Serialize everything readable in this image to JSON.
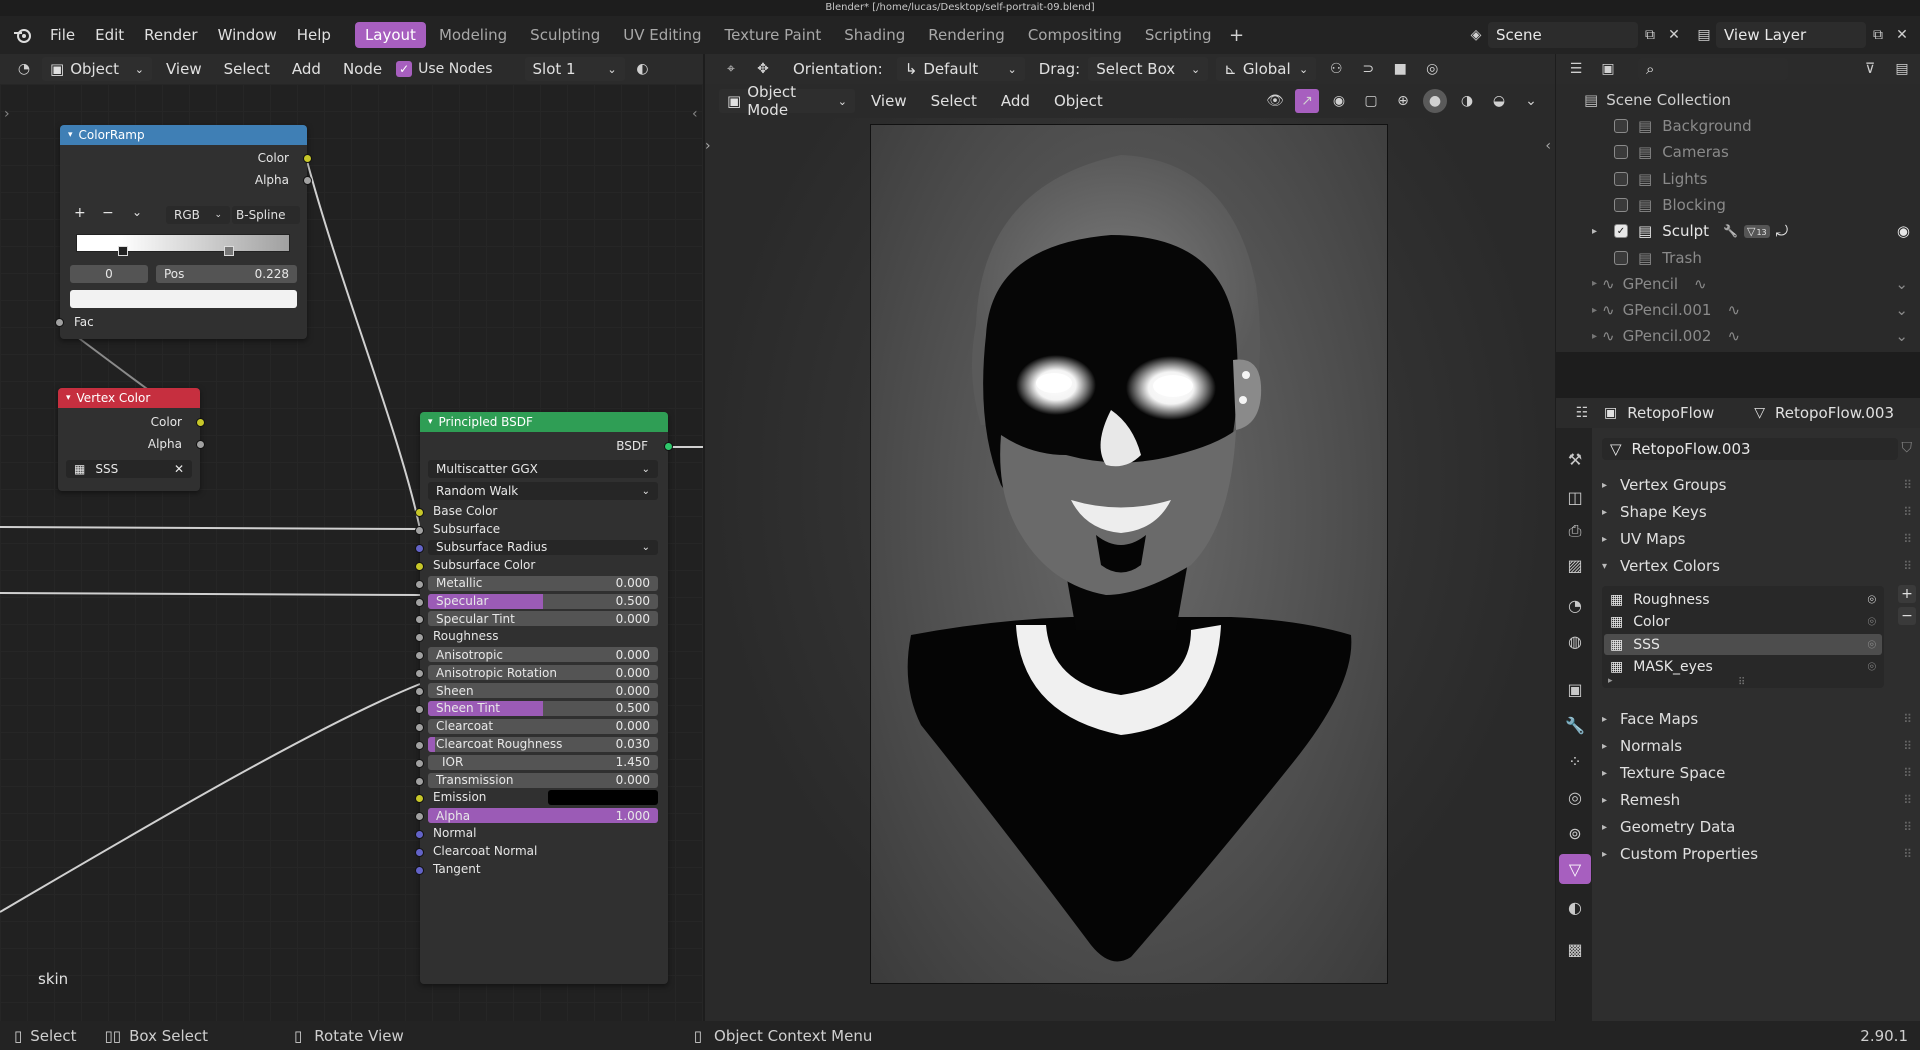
{
  "window_title": "Blender* [/home/lucas/Desktop/self-portrait-09.blend]",
  "menu": [
    "File",
    "Edit",
    "Render",
    "Window",
    "Help"
  ],
  "workspaces": [
    "Layout",
    "Modeling",
    "Sculpting",
    "UV Editing",
    "Texture Paint",
    "Shading",
    "Rendering",
    "Compositing",
    "Scripting"
  ],
  "active_workspace": "Layout",
  "scene": "Scene",
  "view_layer": "View Layer",
  "node_editor": {
    "object_type": "Object",
    "menus": [
      "View",
      "Select",
      "Add",
      "Node"
    ],
    "use_nodes_label": "Use Nodes",
    "slot": "Slot 1",
    "frame_label": "skin",
    "colorramp": {
      "title": "ColorRamp",
      "out_color": "Color",
      "out_alpha": "Alpha",
      "mode": "RGB",
      "interp": "B-Spline",
      "index": "0",
      "pos_label": "Pos",
      "pos_value": "0.228",
      "fac": "Fac"
    },
    "vertex_color": {
      "title": "Vertex Color",
      "out_color": "Color",
      "out_alpha": "Alpha",
      "layer": "SSS"
    },
    "bsdf": {
      "title": "Principled BSDF",
      "output": "BSDF",
      "distribution": "Multiscatter GGX",
      "subsurface_method": "Random Walk",
      "inputs_plain": {
        "base_color": "Base Color",
        "subsurface": "Subsurface",
        "subsurface_radius": "Subsurface Radius",
        "subsurface_color": "Subsurface Color",
        "roughness": "Roughness",
        "emission": "Emission",
        "normal": "Normal",
        "clearcoat_normal": "Clearcoat Normal",
        "tangent": "Tangent"
      },
      "sliders": [
        {
          "label": "Metallic",
          "value": "0.000",
          "fill": 0
        },
        {
          "label": "Specular",
          "value": "0.500",
          "fill": 0.5
        },
        {
          "label": "Specular Tint",
          "value": "0.000",
          "fill": 0
        },
        {
          "label": "Anisotropic",
          "value": "0.000",
          "fill": 0
        },
        {
          "label": "Anisotropic Rotation",
          "value": "0.000",
          "fill": 0
        },
        {
          "label": "Sheen",
          "value": "0.000",
          "fill": 0
        },
        {
          "label": "Sheen Tint",
          "value": "0.500",
          "fill": 0.5
        },
        {
          "label": "Clearcoat",
          "value": "0.000",
          "fill": 0
        },
        {
          "label": "Clearcoat Roughness",
          "value": "0.030",
          "fill": 0.03
        },
        {
          "label": "IOR",
          "value": "1.450",
          "fill": 0
        },
        {
          "label": "Transmission",
          "value": "0.000",
          "fill": 0
        },
        {
          "label": "Alpha",
          "value": "1.000",
          "fill": 1
        }
      ]
    }
  },
  "viewport": {
    "orientation_label": "Orientation:",
    "orientation": "Default",
    "drag_label": "Drag:",
    "drag": "Select Box",
    "transform": "Global",
    "mode": "Object Mode",
    "menus": [
      "View",
      "Select",
      "Add",
      "Object"
    ]
  },
  "outliner": {
    "root": "Scene Collection",
    "items": [
      {
        "name": "Background",
        "checked": false,
        "dim": true
      },
      {
        "name": "Cameras",
        "checked": false,
        "dim": true
      },
      {
        "name": "Lights",
        "checked": false,
        "dim": true
      },
      {
        "name": "Blocking",
        "checked": false,
        "dim": true
      },
      {
        "name": "Sculpt",
        "checked": true,
        "dim": false
      },
      {
        "name": "Trash",
        "checked": false,
        "dim": true
      }
    ],
    "gpencils": [
      "GPencil",
      "GPencil.001",
      "GPencil.002"
    ],
    "sculpt_badge": "13"
  },
  "properties": {
    "object": "RetopoFlow",
    "mesh": "RetopoFlow.003",
    "datablock": "RetopoFlow.003",
    "sections_top": [
      "Vertex Groups",
      "Shape Keys",
      "UV Maps"
    ],
    "vertex_colors_label": "Vertex Colors",
    "vertex_colors": [
      "Roughness",
      "Color",
      "SSS",
      "MASK_eyes"
    ],
    "active_vertex_color": "SSS",
    "sections_bottom": [
      "Face Maps",
      "Normals",
      "Texture Space",
      "Remesh",
      "Geometry Data",
      "Custom Properties"
    ]
  },
  "status": {
    "select": "Select",
    "box_select": "Box Select",
    "rotate_view": "Rotate View",
    "context_menu": "Object Context Menu",
    "version": "2.90.1"
  },
  "colors": {
    "accent": "#a75fbf",
    "socket_yellow": "#c7c729",
    "socket_grey": "#a1a1a1",
    "socket_blue": "#6363c7",
    "bsdf_header": "#2f9e55",
    "vc_header": "#c62f3f",
    "ramp_header": "#3f7fb5"
  }
}
